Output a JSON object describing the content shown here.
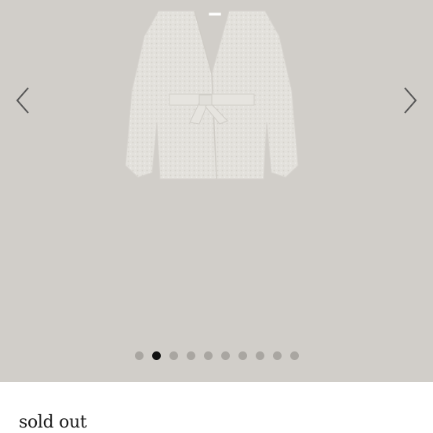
{
  "gallery": {
    "background": "#d1cec9",
    "image": {
      "icon": "cardigan-product-image",
      "color": "#e4e2dd"
    },
    "prev_icon": "chevron-left-icon",
    "next_icon": "chevron-right-icon",
    "slide_count": 10,
    "active_slide": 2,
    "dot_color": "#a9a6a1",
    "dot_active_color": "#111111"
  },
  "status": {
    "label": "sold out"
  }
}
